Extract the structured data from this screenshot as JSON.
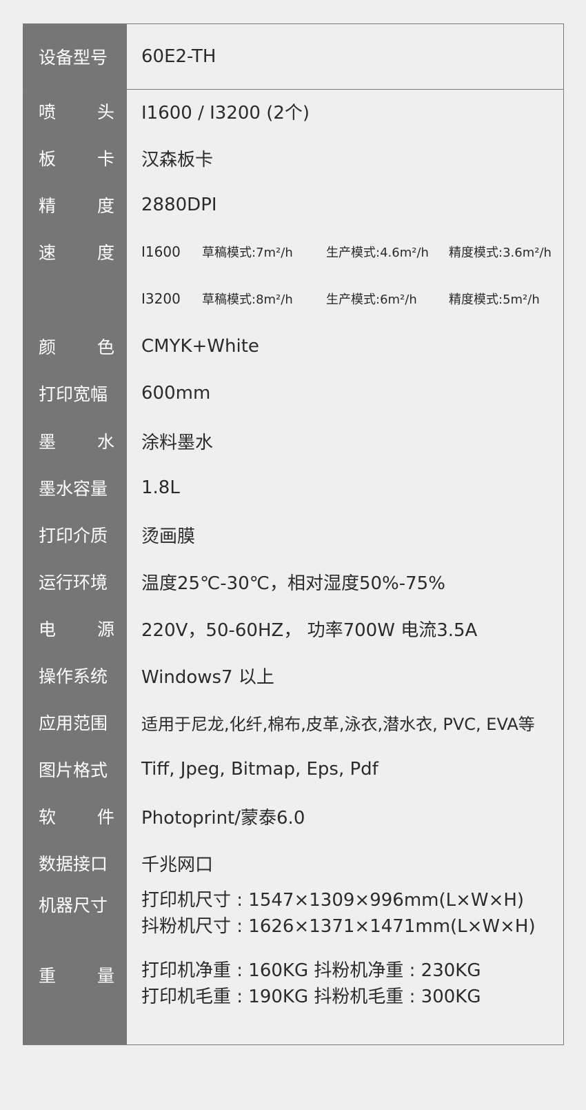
{
  "specs": {
    "model": {
      "label": "设备型号",
      "value": "60E2-TH"
    },
    "nozzle": {
      "label": [
        "喷",
        "头"
      ],
      "value": "I1600 / I3200 (2个)"
    },
    "board": {
      "label": [
        "板",
        "卡"
      ],
      "value": "汉森板卡"
    },
    "precision": {
      "label": [
        "精",
        "度"
      ],
      "value": "2880DPI"
    },
    "speed": {
      "label": [
        "速",
        "度"
      ],
      "rows": [
        {
          "head": "I1600",
          "draft": "草稿模式:7m²/h",
          "production": "生产模式:4.6m²/h",
          "fine": "精度模式:3.6m²/h"
        },
        {
          "head": "I3200",
          "draft": "草稿模式:8m²/h",
          "production": "生产模式:6m²/h",
          "fine": "精度模式:5m²/h"
        }
      ]
    },
    "color": {
      "label": [
        "颜",
        "色"
      ],
      "value": "CMYK+White"
    },
    "print_width": {
      "label": "打印宽幅",
      "value": "600mm"
    },
    "ink": {
      "label": [
        "墨",
        "水"
      ],
      "value": "涂料墨水"
    },
    "ink_capacity": {
      "label": "墨水容量",
      "value": "1.8L"
    },
    "media": {
      "label": "打印介质",
      "value": "烫画膜"
    },
    "environment": {
      "label": "运行环境",
      "value": "温度25℃-30℃，相对湿度50%-75%"
    },
    "power": {
      "label": [
        "电",
        "源"
      ],
      "value": "220V，50-60HZ， 功率700W  电流3.5A"
    },
    "os": {
      "label": "操作系统",
      "value": "Windows7 以上"
    },
    "application": {
      "label": "应用范围",
      "value": "适用于尼龙,化纤,棉布,皮革,泳衣,潜水衣, PVC, EVA等"
    },
    "image_format": {
      "label": "图片格式",
      "value": "Tiff, Jpeg, Bitmap, Eps, Pdf"
    },
    "software": {
      "label": [
        "软",
        "件"
      ],
      "value": "Photoprint/蒙泰6.0"
    },
    "interface": {
      "label": "数据接口",
      "value": "千兆网口"
    },
    "dimensions": {
      "label": "机器尺寸",
      "lines": [
        "打印机尺寸 : 1547×1309×996mm(L×W×H)",
        "抖粉机尺寸 : 1626×1371×1471mm(L×W×H)"
      ]
    },
    "weight": {
      "label": [
        "重",
        "量"
      ],
      "lines": [
        "打印机净重 : 160KG  抖粉机净重 : 230KG",
        "打印机毛重 : 190KG  抖粉机毛重 : 300KG"
      ]
    }
  }
}
